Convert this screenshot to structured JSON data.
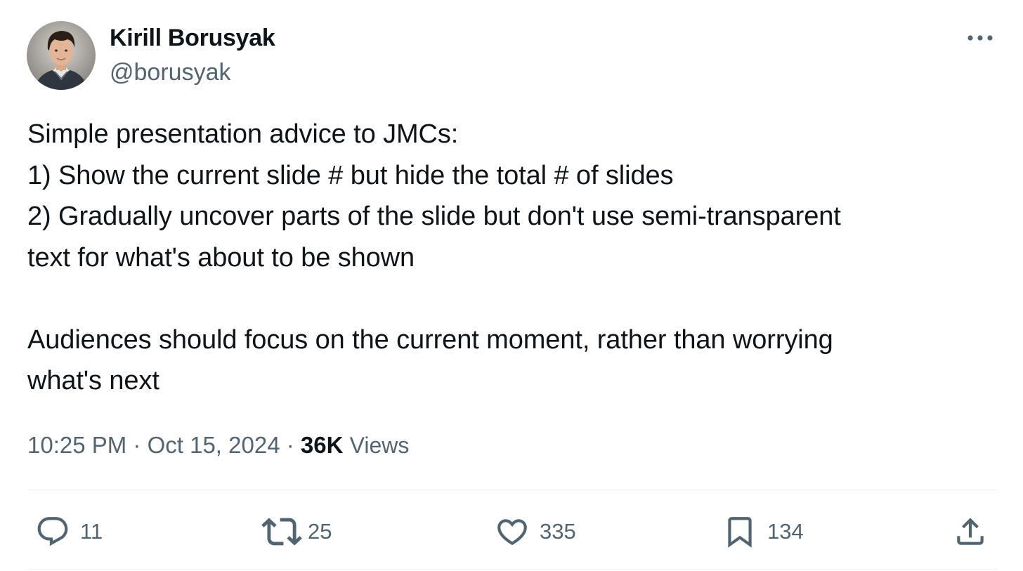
{
  "author": {
    "name": "Kirill Borusyak",
    "handle": "@borusyak"
  },
  "tweet": {
    "lines": [
      "Simple presentation advice to JMCs:",
      "1) Show the current slide # but hide the total # of slides",
      "2) Gradually uncover parts of the slide but don't use semi-transparent",
      "text for what's about to be shown",
      "Audiences should focus on the current moment, rather than worrying",
      "what's next"
    ]
  },
  "meta": {
    "time": "10:25 PM",
    "separator": "·",
    "date": "Oct 15, 2024",
    "views_count": "36K",
    "views_label": "Views"
  },
  "actions": {
    "reply": {
      "icon": "reply-icon",
      "count": "11"
    },
    "retweet": {
      "icon": "retweet-icon",
      "count": "25"
    },
    "like": {
      "icon": "heart-icon",
      "count": "335"
    },
    "bookmark": {
      "icon": "bookmark-icon",
      "count": "134"
    },
    "share": {
      "icon": "share-icon"
    }
  },
  "colors": {
    "text_primary": "#0f1419",
    "text_secondary": "#536471",
    "divider": "#eff3f4"
  }
}
